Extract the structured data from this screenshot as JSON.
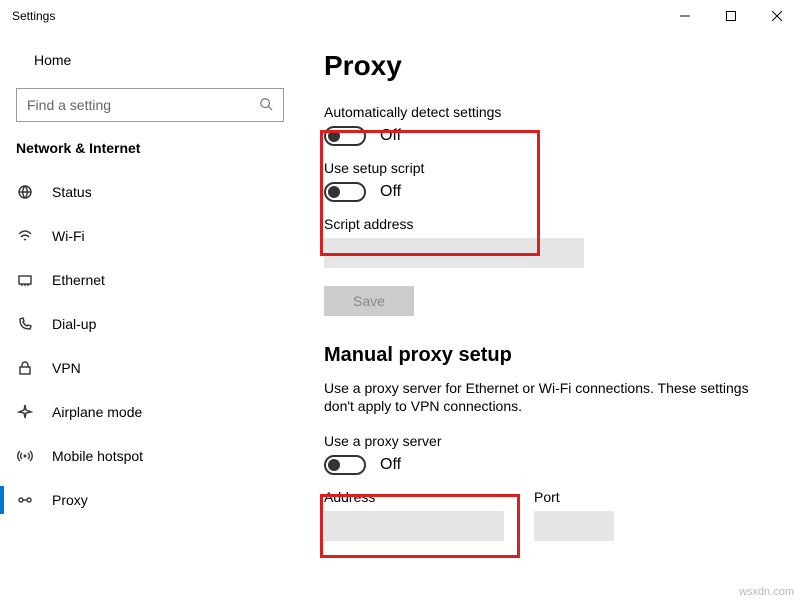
{
  "window": {
    "title": "Settings"
  },
  "sidebar": {
    "home": "Home",
    "search_placeholder": "Find a setting",
    "section": "Network & Internet",
    "items": [
      {
        "label": "Status"
      },
      {
        "label": "Wi-Fi"
      },
      {
        "label": "Ethernet"
      },
      {
        "label": "Dial-up"
      },
      {
        "label": "VPN"
      },
      {
        "label": "Airplane mode"
      },
      {
        "label": "Mobile hotspot"
      },
      {
        "label": "Proxy"
      }
    ]
  },
  "main": {
    "title": "Proxy",
    "auto_detect_label": "Automatically detect settings",
    "auto_detect_state": "Off",
    "setup_script_label": "Use setup script",
    "setup_script_state": "Off",
    "script_address_label": "Script address",
    "save_label": "Save",
    "manual_title": "Manual proxy setup",
    "manual_hint": "Use a proxy server for Ethernet or Wi-Fi connections. These settings don't apply to VPN connections.",
    "use_proxy_label": "Use a proxy server",
    "use_proxy_state": "Off",
    "address_label": "Address",
    "port_label": "Port"
  },
  "watermark": "wsxdn.com"
}
